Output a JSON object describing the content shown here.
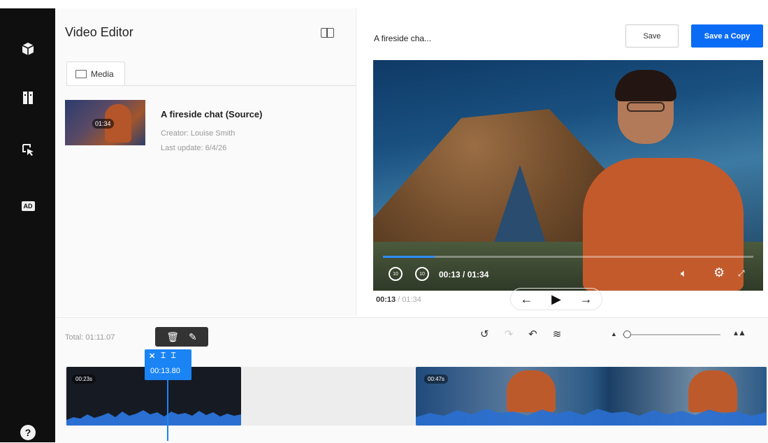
{
  "app": {
    "title": "Video Editor"
  },
  "sidebar": {
    "items": [
      {
        "icon": "cube-icon"
      },
      {
        "icon": "book-icon"
      },
      {
        "icon": "cursor-select-icon"
      },
      {
        "icon": "ad-icon",
        "label": "AD"
      }
    ],
    "help_label": "?"
  },
  "media_panel": {
    "tab_label": "Media",
    "item": {
      "title": "A fireside chat (Source)",
      "duration": "01:34",
      "creator": "Creator: Louise Smith",
      "updated": "Last update: 6/4/26"
    }
  },
  "preview": {
    "title": "A fireside cha...",
    "save_label": "Save",
    "save_copy_label": "Save a Copy",
    "overlay_time": "00:13 / 01:34",
    "rewind_label": "10",
    "forward_label": "10",
    "progress_fraction": 0.14,
    "current_time": "00:13",
    "separator": " / ",
    "total_time": "01:34"
  },
  "timeline": {
    "total": "Total: 01:11.07",
    "playhead_time": "00:13.80",
    "clips": [
      {
        "label": "00:23s"
      },
      {
        "label": "00:47s"
      }
    ]
  },
  "colors": {
    "accent": "#0a6cf4",
    "sidebar_bg": "#0f0f0f",
    "playhead": "#1a84f5"
  }
}
